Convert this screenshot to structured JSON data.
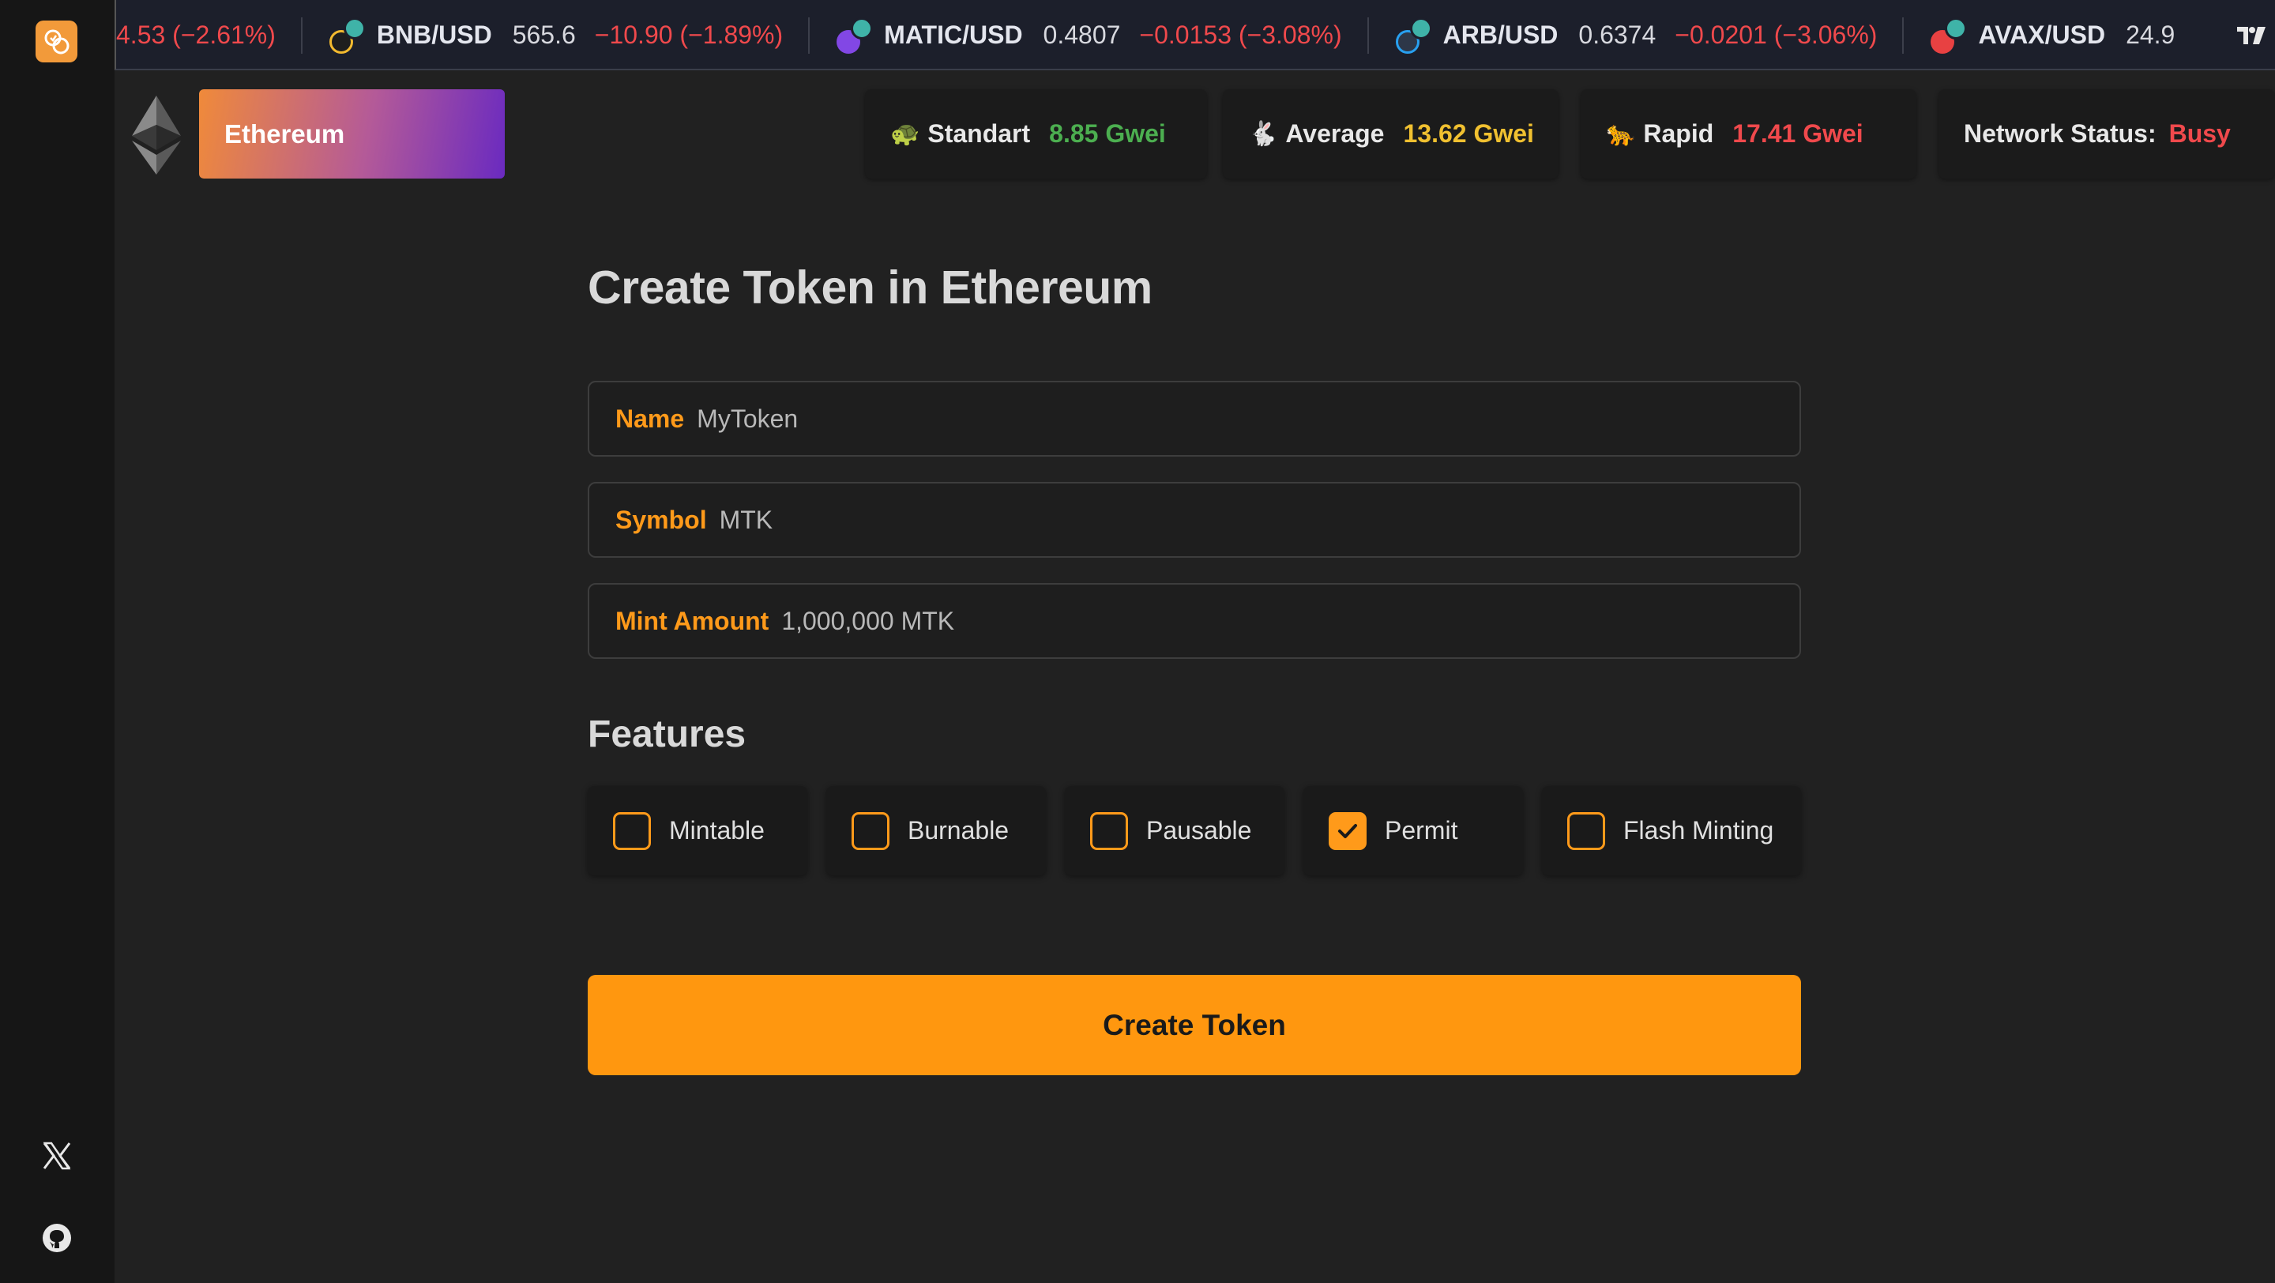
{
  "ticker": {
    "items": [
      {
        "symbol": "",
        "price": "",
        "change": "4.53 (−2.61%)"
      },
      {
        "symbol": "BNB/USD",
        "price": "565.6",
        "change": "−10.90 (−1.89%)",
        "coin_color": "#f3ba2f"
      },
      {
        "symbol": "MATIC/USD",
        "price": "0.4807",
        "change": "−0.0153 (−3.08%)",
        "coin_color": "#8247e5"
      },
      {
        "symbol": "ARB/USD",
        "price": "0.6374",
        "change": "−0.0201 (−3.06%)",
        "coin_color": "#28a0f0"
      },
      {
        "symbol": "AVAX/USD",
        "price": "24.9",
        "change": "",
        "coin_color": "#e84142"
      }
    ],
    "change_color": "#f0494c"
  },
  "header": {
    "network_label": "Ethereum",
    "gas": [
      {
        "icon": "turtle-icon",
        "emoji": "🐢",
        "label": "Standart",
        "value": "8.85 Gwei",
        "color": "#4caf50"
      },
      {
        "icon": "rabbit-icon",
        "emoji": "🐇",
        "label": "Average",
        "value": "13.62 Gwei",
        "color": "#f0c030"
      },
      {
        "icon": "leopard-icon",
        "emoji": "🐆",
        "label": "Rapid",
        "value": "17.41 Gwei",
        "color": "#f0494c"
      }
    ],
    "network_status_label": "Network Status:",
    "network_status_value": "Busy",
    "network_status_color": "#f0494c"
  },
  "form": {
    "title": "Create Token in Ethereum",
    "name_label": "Name",
    "name_value": "MyToken",
    "symbol_label": "Symbol",
    "symbol_value": "MTK",
    "mint_label": "Mint Amount",
    "mint_value": "1,000,000 MTK",
    "features_title": "Features",
    "features": [
      {
        "label": "Mintable",
        "checked": false
      },
      {
        "label": "Burnable",
        "checked": false
      },
      {
        "label": "Pausable",
        "checked": false
      },
      {
        "label": "Permit",
        "checked": true
      },
      {
        "label": "Flash Minting",
        "checked": false
      }
    ],
    "submit_label": "Create Token"
  },
  "sidebar": {
    "icons": [
      "app-logo-icon",
      "x-twitter-icon",
      "github-icon"
    ],
    "accent": "#f29a3a"
  }
}
